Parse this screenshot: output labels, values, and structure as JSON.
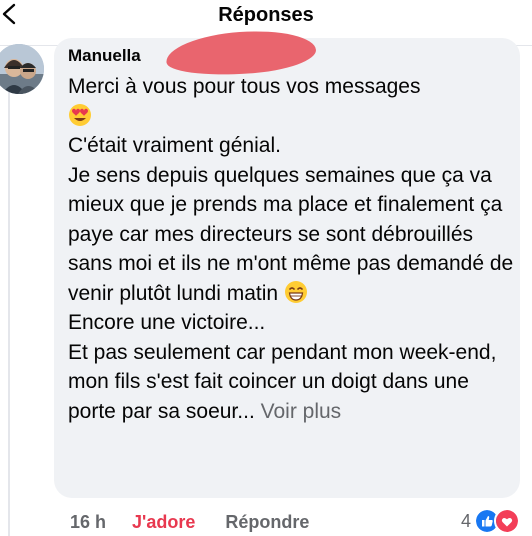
{
  "header": {
    "title": "Réponses"
  },
  "comment": {
    "author": "Manuella",
    "lines": [
      "Merci à vous pour tous vos messages",
      "C'était vraiment génial.",
      "Je sens depuis quelques semaines que ça va mieux que je prends ma place et finalement ça paye car mes directeurs se sont débrouillés sans moi et ils ne m'ont même pas demandé de venir plutôt lundi matin",
      "Encore une victoire...",
      "Et pas seulement car pendant mon week-end, mon fils s'est fait coincer un doigt dans une porte par sa soeur..."
    ],
    "see_more": "Voir plus"
  },
  "actions": {
    "time": "16 h",
    "love": "J'adore",
    "reply": "Répondre",
    "reaction_count": "4"
  },
  "icons": {
    "back": "back-arrow-icon",
    "heart_eyes": "heart-eyes-emoji-icon",
    "grin": "grinning-emoji-icon",
    "like": "like-reaction-icon",
    "love": "love-reaction-icon"
  },
  "colors": {
    "bubble": "#f0f2f5",
    "love_action": "#e8384f",
    "like_blue": "#1877f2",
    "love_red": "#f33e58"
  }
}
